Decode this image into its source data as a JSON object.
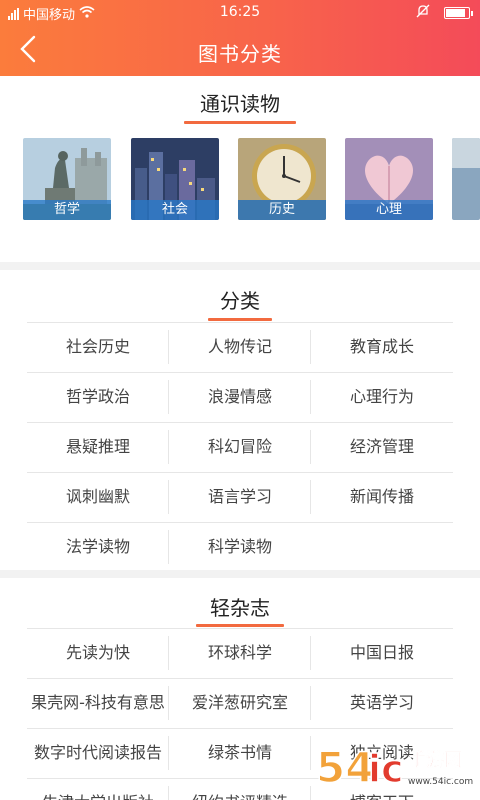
{
  "status_bar": {
    "carrier": "中国移动",
    "time": "16:25"
  },
  "header": {
    "title": "图书分类"
  },
  "general_reading": {
    "title": "通识读物",
    "covers": [
      {
        "label": "哲学"
      },
      {
        "label": "社会"
      },
      {
        "label": "历史"
      },
      {
        "label": "心理"
      }
    ]
  },
  "categories": {
    "title": "分类",
    "items": [
      "社会历史",
      "人物传记",
      "教育成长",
      "哲学政治",
      "浪漫情感",
      "心理行为",
      "悬疑推理",
      "科幻冒险",
      "经济管理",
      "讽刺幽默",
      "语言学习",
      "新闻传播",
      "法学读物",
      "科学读物"
    ]
  },
  "magazines": {
    "title": "轻杂志",
    "items": [
      "先读为快",
      "环球科学",
      "中国日报",
      "果壳网-科技有意思",
      "爱洋葱研究室",
      "英语学习",
      "数字时代阅读报告",
      "绿茶书情",
      "独立阅读",
      "牛津大学出版社",
      "纽约书评精选",
      "博客天下"
    ]
  },
  "watermark": {
    "text": "手游网",
    "url": "www.54ic.com"
  },
  "colors": {
    "header_start": "#fb7c3c",
    "header_end": "#f44b59",
    "accent": "#f26a3f"
  }
}
